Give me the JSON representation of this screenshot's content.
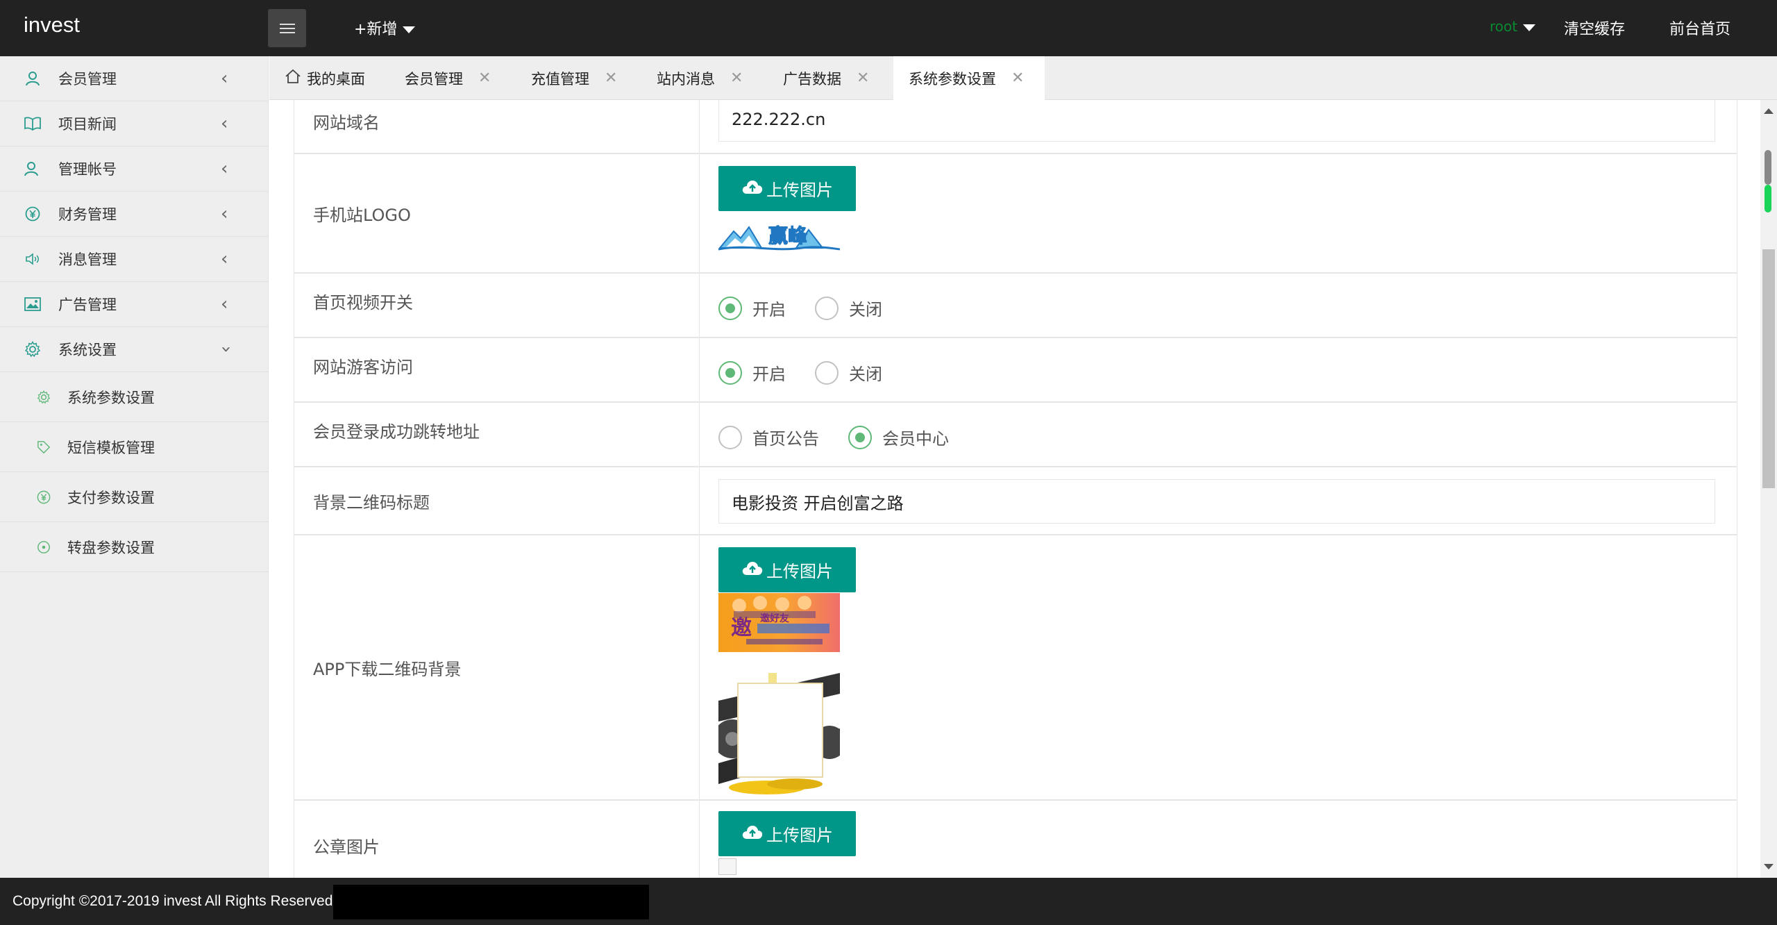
{
  "header": {
    "logo": "invest",
    "new_label": "+新增",
    "user": "root",
    "clear_cache": "清空缓存",
    "frontpage": "前台首页"
  },
  "sidebar": {
    "items": [
      {
        "label": "会员管理",
        "icon": "user-icon"
      },
      {
        "label": "项目新闻",
        "icon": "book-icon"
      },
      {
        "label": "管理帐号",
        "icon": "users-icon"
      },
      {
        "label": "财务管理",
        "icon": "yen-icon"
      },
      {
        "label": "消息管理",
        "icon": "speaker-icon"
      },
      {
        "label": "广告管理",
        "icon": "image-icon"
      },
      {
        "label": "系统设置",
        "icon": "gear-icon"
      }
    ],
    "subitems": [
      {
        "label": "系统参数设置",
        "icon": "gear-icon"
      },
      {
        "label": "短信模板管理",
        "icon": "tag-icon"
      },
      {
        "label": "支付参数设置",
        "icon": "yen-icon"
      },
      {
        "label": "转盘参数设置",
        "icon": "spin-icon"
      }
    ]
  },
  "tabs": [
    {
      "label": "我的桌面",
      "icon": "home-icon"
    },
    {
      "label": "会员管理"
    },
    {
      "label": "充值管理"
    },
    {
      "label": "站内消息"
    },
    {
      "label": "广告数据"
    },
    {
      "label": "系统参数设置",
      "active": true
    }
  ],
  "form": {
    "domain": {
      "label": "网站域名",
      "value": "222.222.cn"
    },
    "mobile_logo": {
      "label": "手机站LOGO",
      "button": "上传图片",
      "image_text": "赢峰"
    },
    "video_switch": {
      "label": "首页视频开关",
      "options": [
        "开启",
        "关闭"
      ],
      "selected": "开启"
    },
    "guest_access": {
      "label": "网站游客访问",
      "options": [
        "开启",
        "关闭"
      ],
      "selected": "开启"
    },
    "login_redirect": {
      "label": "会员登录成功跳转地址",
      "options": [
        "首页公告",
        "会员中心"
      ],
      "selected": "会员中心"
    },
    "qr_title": {
      "label": "背景二维码标题",
      "value": "电影投资 开启创富之路"
    },
    "app_qr_bg": {
      "label": "APP下载二维码背景",
      "button": "上传图片",
      "banner_text": "邀好友"
    },
    "seal_image": {
      "label": "公章图片",
      "button": "上传图片"
    }
  },
  "footer": {
    "copyright": "Copyright ©2017-2019 invest All Rights Reserved"
  },
  "colors": {
    "header_bg": "#222222",
    "accent_teal": "#009688",
    "radio_green": "#5FB878",
    "user_green": "#0a8a30"
  }
}
